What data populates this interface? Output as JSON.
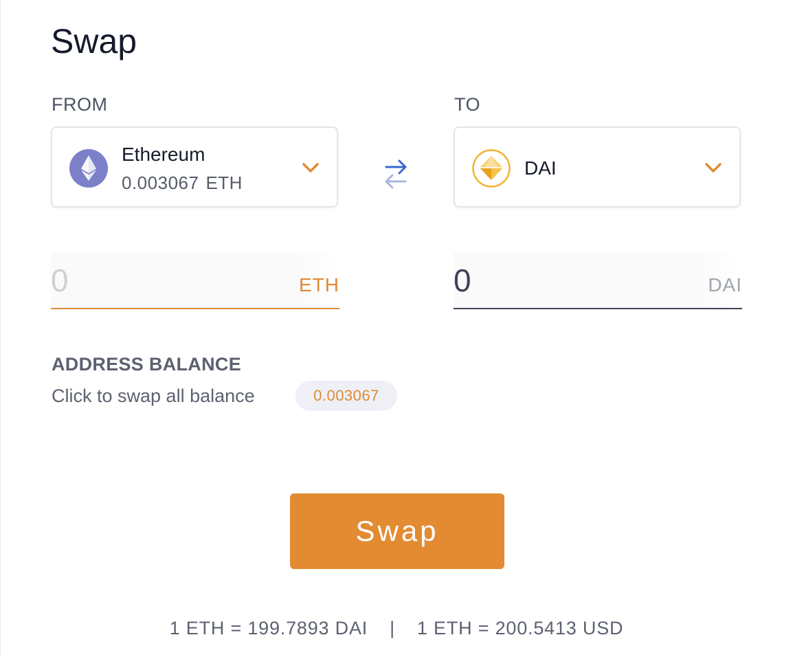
{
  "title": "Swap",
  "from": {
    "label": "FROM",
    "token_name": "Ethereum",
    "token_balance": "0.003067",
    "token_unit": "ETH",
    "token_icon": "ethereum-icon",
    "amount_placeholder": "0",
    "amount_unit": "ETH"
  },
  "to": {
    "label": "TO",
    "token_name": "DAI",
    "token_icon": "dai-icon",
    "amount_value": "0",
    "amount_unit": "DAI"
  },
  "balance": {
    "title": "ADDRESS BALANCE",
    "hint": "Click to swap all balance",
    "value": "0.003067"
  },
  "swap_button_label": "Swap",
  "rates": {
    "eth_dai": "1 ETH = 199.7893 DAI",
    "separator": "|",
    "eth_usd": "1 ETH = 200.5413 USD"
  },
  "colors": {
    "accent": "#e38b33",
    "eth_icon": "#7b80c9",
    "dai_icon": "#f1b32e",
    "swap_arrow_active": "#3a67d1",
    "swap_arrow_inactive": "#aab6e0"
  }
}
